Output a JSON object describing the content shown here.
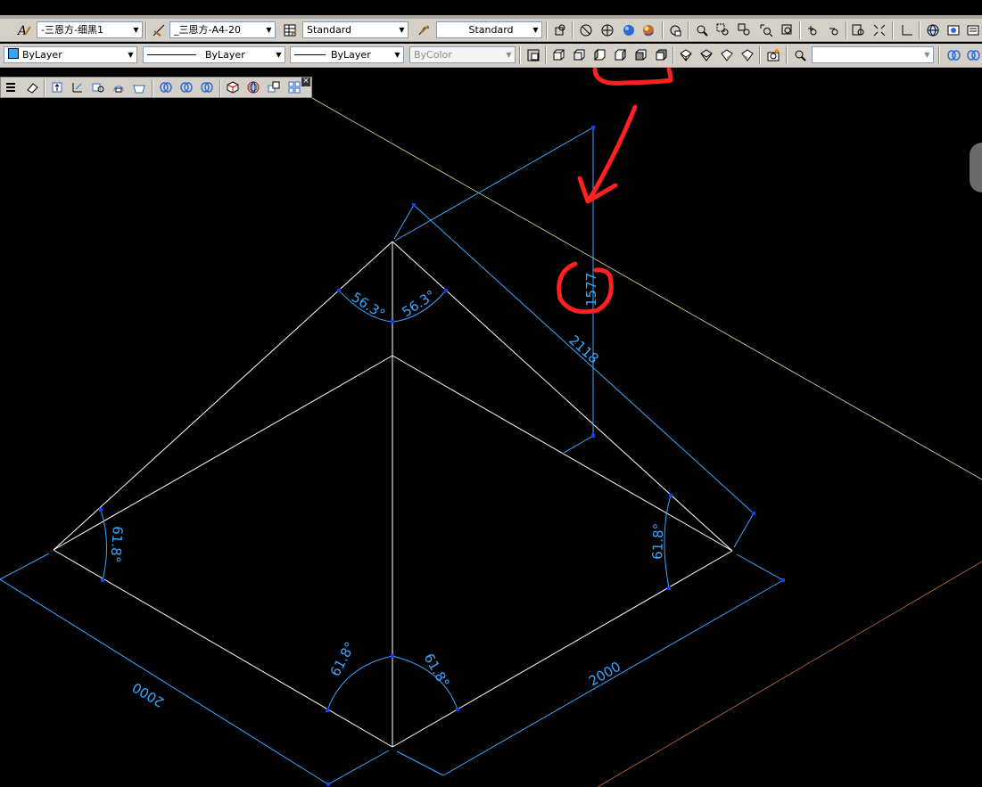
{
  "toolbar_row1": {
    "text_style": "Standard",
    "text_style_prefix_label": "-三恩方-细黑1",
    "dim_style": "_三恩方-A4-20",
    "table_style": "Standard",
    "multileader_style": "Standard"
  },
  "toolbar_row2": {
    "layer_color": "ByLayer",
    "linetype": "ByLayer",
    "lineweight": "ByLayer",
    "plot_style": "ByColor",
    "view_combo": ""
  },
  "drawing": {
    "dimensions": {
      "height": "1577",
      "slant_edge": "2118",
      "left_base": "2000",
      "right_base": "2000",
      "apex_angle_left": "56.3°",
      "apex_angle_right": "56.3°",
      "left_corner_angle": "61.8°",
      "right_corner_angle": "61.8°",
      "bottom_angle_left": "61.8°",
      "bottom_angle_right": "61.8°"
    },
    "colors": {
      "background": "#000000",
      "geometry": "#ffffff",
      "dimension": "#3aa8ff",
      "annotation": "#ff2020",
      "axis_green": "#c8e6a0",
      "axis_red": "#c0704a"
    }
  }
}
